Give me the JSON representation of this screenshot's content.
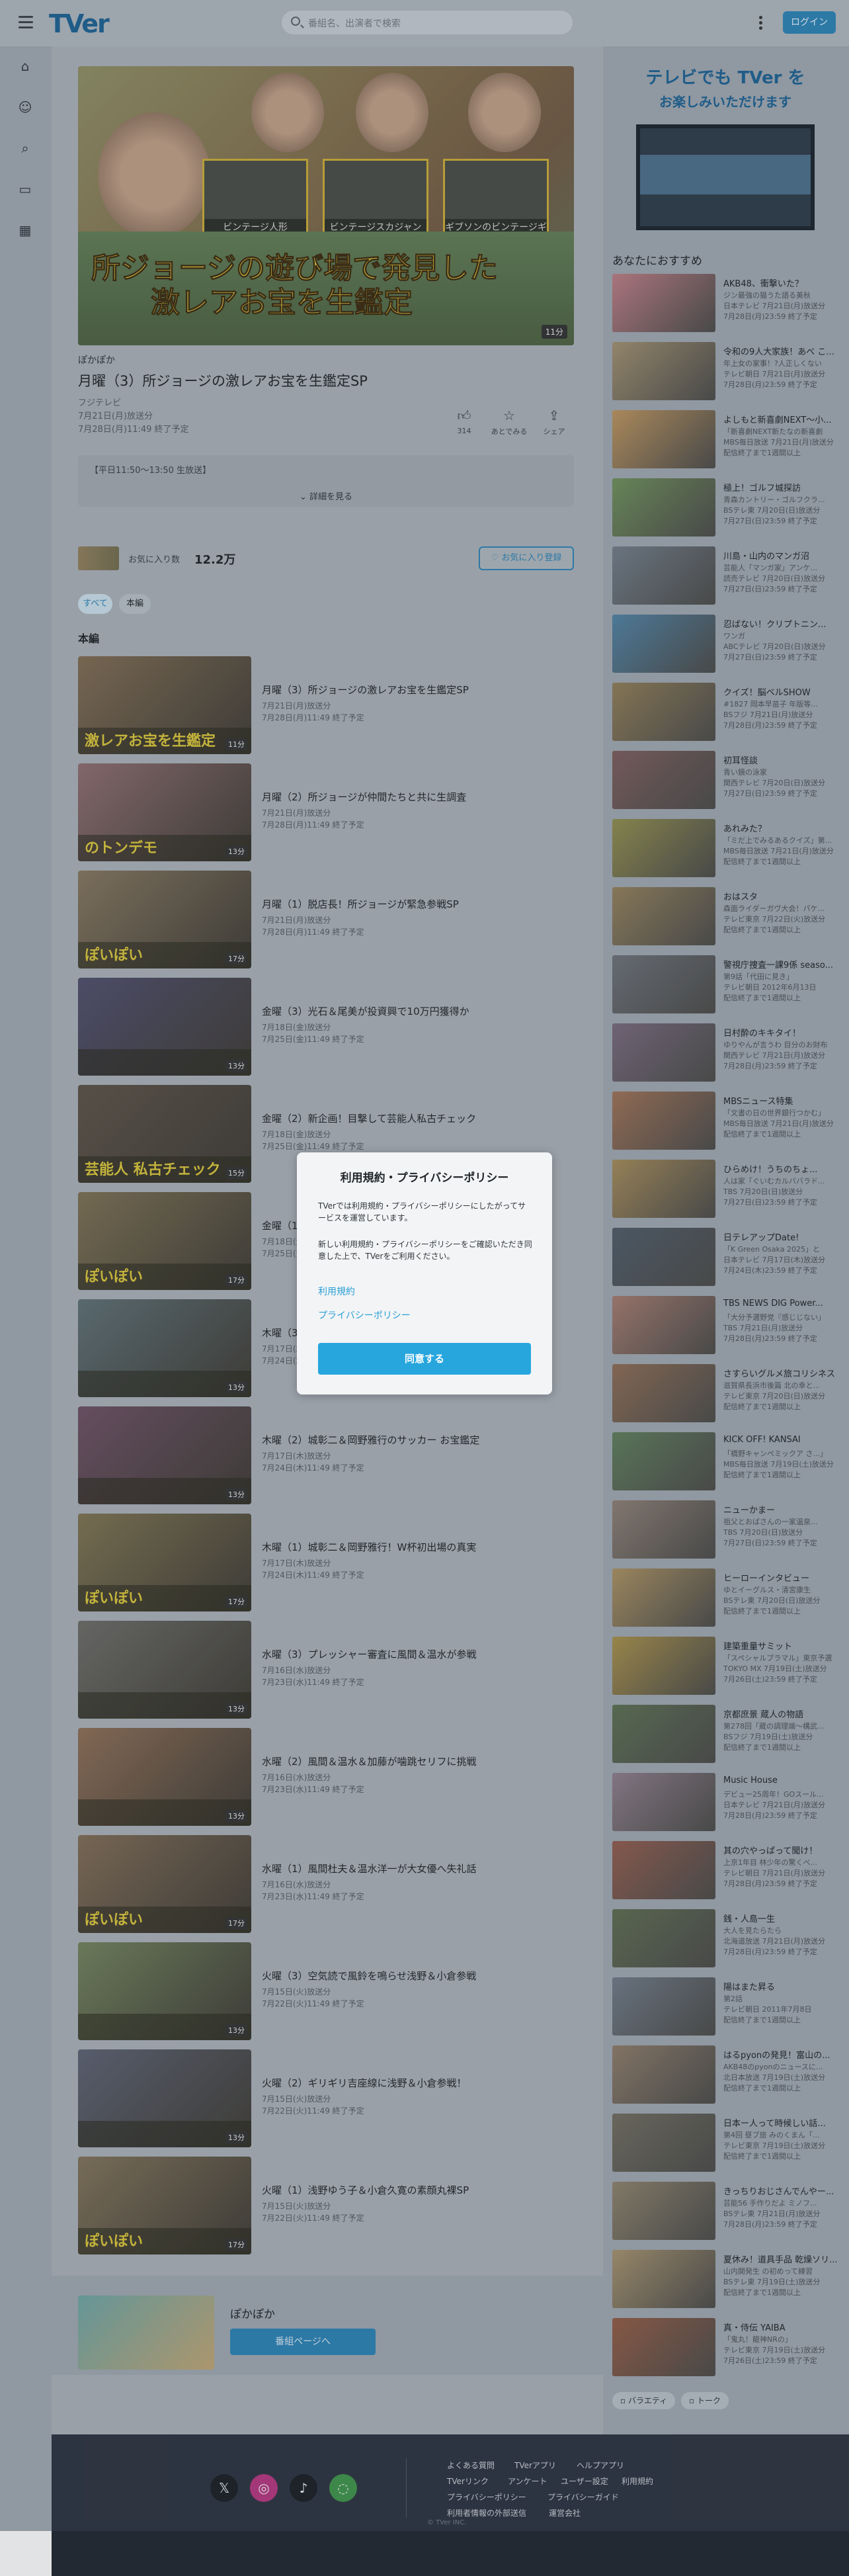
{
  "header": {
    "logo": "TVer",
    "search_placeholder": "番組名、出演者で検索",
    "login_label": "ログイン"
  },
  "rail_icons": [
    "home-icon",
    "person-icon",
    "search-icon",
    "tv-icon",
    "grid-icon"
  ],
  "hero": {
    "panels": [
      "ビンテージ人形",
      "ビンテージスカジャン",
      "ギブソンのビンテージギター"
    ],
    "title_line1": "所ジョージの遊び場で発見した",
    "title_line2": "激レアお宝を生鑑定",
    "duration": "11分"
  },
  "episode": {
    "series": "ぽかぽか",
    "title": "月曜（3）所ジョージの激レアお宝を生鑑定SP",
    "broadcaster": "フジテレビ",
    "aired": "7月21日(月)放送分",
    "expires": "7月28日(月)11:49 終了予定",
    "actions": [
      {
        "icon": "thumb-up-icon",
        "label": "314"
      },
      {
        "icon": "star-icon",
        "label": "あとでみる"
      },
      {
        "icon": "share-icon",
        "label": "シェア"
      }
    ],
    "description": "【平日11:50～13:50 生放送】",
    "more_label": "詳細を見る"
  },
  "favorites": {
    "label": "お気に入り数",
    "count": "12.2万",
    "button": "お気に入り登録"
  },
  "chips": [
    "すべて",
    "本編"
  ],
  "section_title": "本編",
  "episodes": [
    {
      "title": "月曜（3）所ジョージの激レアお宝を生鑑定SP",
      "aired": "7月21日(月)放送分",
      "expires": "7月28日(月)11:49 終了予定",
      "caption": "激レアお宝を生鑑定",
      "duration": "11分",
      "color": "#7d6a52"
    },
    {
      "title": "月曜（2）所ジョージが仲間たちと共に生調査",
      "aired": "7月21日(月)放送分",
      "expires": "7月28日(月)11:49 終了予定",
      "caption": "のトンデモ",
      "duration": "13分",
      "color": "#8a6b6e"
    },
    {
      "title": "月曜（1）脱店長！所ジョージが緊急参戦SP",
      "aired": "7月21日(月)放送分",
      "expires": "7月28日(月)11:49 終了予定",
      "caption": "ぽいぽい",
      "duration": "17分",
      "color": "#82745d"
    },
    {
      "title": "金曜（3）光石＆尾美が投資興で10万円獲得か",
      "aired": "7月18日(金)放送分",
      "expires": "7月25日(金)11:49 終了予定",
      "caption": "",
      "duration": "13分",
      "color": "#4e4d6b"
    },
    {
      "title": "金曜（2）新企画！目撃して芸能人私古チェック",
      "aired": "7月18日(金)放送分",
      "expires": "7月25日(金)11:49 終了予定",
      "caption": "芸能人 私古チェック",
      "duration": "15分",
      "color": "#5b5147"
    },
    {
      "title": "金曜（1）光石研＆尾美としのりが登場",
      "aired": "7月18日(金)放送分",
      "expires": "7月25日(金)11:49 終了予定",
      "caption": "ぽいぽい",
      "duration": "17分",
      "color": "#7a6e52"
    },
    {
      "title": "木曜（3）城彰二＆岡野雅行の秘話トーク",
      "aired": "7月17日(木)放送分",
      "expires": "7月24日(木)11:49 終了予定",
      "caption": "",
      "duration": "13分",
      "color": "#5c6d72"
    },
    {
      "title": "木曜（2）城彰二＆岡野雅行のサッカー お宝鑑定",
      "aired": "7月17日(木)放送分",
      "expires": "7月24日(木)11:49 終了予定",
      "caption": "",
      "duration": "13分",
      "color": "#6a4f62"
    },
    {
      "title": "木曜（1）城彰二＆岡野雅行！W杯初出場の真実",
      "aired": "7月17日(木)放送分",
      "expires": "7月24日(木)11:49 終了予定",
      "caption": "ぽいぽい",
      "duration": "17分",
      "color": "#7b7150"
    },
    {
      "title": "水曜（3）プレッシャー審査に風間＆温水が参戦",
      "aired": "7月16日(水)放送分",
      "expires": "7月23日(水)11:49 終了予定",
      "caption": "",
      "duration": "13分",
      "color": "#6a6a66"
    },
    {
      "title": "水曜（2）風間＆温水＆加藤が噛跳セリフに挑戦",
      "aired": "7月16日(水)放送分",
      "expires": "7月23日(水)11:49 終了予定",
      "caption": "",
      "duration": "13分",
      "color": "#8a6c55"
    },
    {
      "title": "水曜（1）風間杜夫＆温水洋一が大女優へ失礼話",
      "aired": "7月16日(水)放送分",
      "expires": "7月23日(水)11:49 終了予定",
      "caption": "ぽいぽい",
      "duration": "17分",
      "color": "#7d6a55"
    },
    {
      "title": "火曜（3）空気読で風鈴を鳴らせ浅野＆小倉参戦",
      "aired": "7月15日(火)放送分",
      "expires": "7月22日(火)11:49 終了予定",
      "caption": "",
      "duration": "13分",
      "color": "#6f7f5b"
    },
    {
      "title": "火曜（2）ギリギリ吉座線に浅野＆小倉参戦！",
      "aired": "7月15日(火)放送分",
      "expires": "7月22日(火)11:49 終了予定",
      "caption": "",
      "duration": "13分",
      "color": "#5b6070"
    },
    {
      "title": "火曜（1）浅野ゆう子＆小倉久寛の素顔丸裸SP",
      "aired": "7月15日(火)放送分",
      "expires": "7月22日(火)11:49 終了予定",
      "caption": "ぽいぽい",
      "duration": "17分",
      "color": "#7d7058"
    }
  ],
  "series_card": {
    "name": "ぽかぽか",
    "button": "番組ページへ"
  },
  "side": {
    "promo_line1": "テレビでも TVer を",
    "promo_line2": "お楽しみいただけます",
    "heading": "あなたにおすすめ",
    "items": [
      {
        "title": "AKB48、衝撃いた？",
        "sub": "ジン最強の猫うた語る美秋",
        "meta": "日本テレビ 7月21日(月)放送分",
        "exp": "7月28日(月)23:59 終了予定",
        "color": "#b77a82"
      },
      {
        "title": "令和の9人大家族！あべ こ...",
        "sub": "年上女の家事！?人正しくない",
        "meta": "テレビ朝日 7月21日(月)放送分",
        "exp": "7月28日(月)23:59 終了予定",
        "color": "#9c8c6e"
      },
      {
        "title": "よしもと新喜劇NEXT～小...",
        "sub": "「新喜劇NEXT新たなの新喜劇",
        "meta": "MBS毎日放送 7月21日(月)放送分",
        "exp": "配信終了まで1週間以上",
        "color": "#b7905d"
      },
      {
        "title": "極上！ゴルフ城探訪",
        "sub": "青森カントリー・ゴルフクラ...",
        "meta": "BSテレ東 7月20日(日)放送分",
        "exp": "7月27日(日)23:59 終了予定",
        "color": "#6c8c59"
      },
      {
        "title": "川島・山内のマンガ沼",
        "sub": "芸能人「マンガ家」アンケ...",
        "meta": "読売テレビ 7月20日(日)放送分",
        "exp": "7月27日(日)23:59 終了予定",
        "color": "#6f7a86"
      },
      {
        "title": "忍ばない！クリプトニン...",
        "sub": "ワンガ",
        "meta": "ABCテレビ 7月20日(日)放送分",
        "exp": "7月27日(日)23:59 終了予定",
        "color": "#4f7fa0"
      },
      {
        "title": "クイズ！脳ベルSHOW",
        "sub": "#1827 岡本早苗子 年版等...",
        "meta": "BSフジ 7月21日(月)放送分",
        "exp": "7月28日(月)23:59 終了予定",
        "color": "#8c7a56"
      },
      {
        "title": "初耳怪談",
        "sub": "青い鏡の泳家",
        "meta": "関西テレビ 7月20日(日)放送分",
        "exp": "7月27日(日)23:59 終了予定",
        "color": "#7a5b5b"
      },
      {
        "title": "あれみた？",
        "sub": "「ミだ上でみるあるクイズ」第...",
        "meta": "MBS毎日放送 7月21日(月)放送分",
        "exp": "配信終了まで1週間以上",
        "color": "#8d8a4d"
      },
      {
        "title": "おはスタ",
        "sub": "森面ライダーガヴ大会！パケ...",
        "meta": "テレビ東京 7月22日(火)放送分",
        "exp": "配信終了まで1週間以上",
        "color": "#8f7d5a"
      },
      {
        "title": "警視庁捜査一課9係 seaso...",
        "sub": "第9話「代田に見き」",
        "meta": "テレビ朝日 2012年6月13日",
        "exp": "配信終了まで1週間以上",
        "color": "#6a6f76"
      },
      {
        "title": "日村酔のキキタイ！",
        "sub": "ゆりやんが言うわ 目分のお財布",
        "meta": "関西テレビ 7月21日(月)放送分",
        "exp": "7月28日(月)23:59 終了予定",
        "color": "#75677a"
      },
      {
        "title": "MBSニュース特集",
        "sub": "「文書の日の世界銀行つかむ」",
        "meta": "MBS毎日放送 7月21日(月)放送分",
        "exp": "配信終了まで1週間以上",
        "color": "#9a6f55"
      },
      {
        "title": "ひらめけ！うちのちょ...",
        "sub": "人は家「ぐいむカルババラド...",
        "meta": "TBS 7月20日(日)放送分",
        "exp": "7月27日(日)23:59 終了予定",
        "color": "#a08758"
      },
      {
        "title": "日テレアップDate!",
        "sub": "「K Green Osaka 2025」と",
        "meta": "日本テレビ 7月17日(木)放送分",
        "exp": "7月24日(木)23:59 終了予定",
        "color": "#4d5966"
      },
      {
        "title": "TBS NEWS DIG Power...",
        "sub": "「大分予選野党『感じじない」",
        "meta": "TBS 7月21日(月)放送分",
        "exp": "7月28日(月)23:59 終了予定",
        "color": "#a0786d"
      },
      {
        "title": "さすらいグルメ旅コリシネス",
        "sub": "滋賀県長浜市後篇 北の幸と...",
        "meta": "テレビ東京 7月20日(日)放送分",
        "exp": "配信終了まで1週間以上",
        "color": "#8a6a54"
      },
      {
        "title": "KICK OFF! KANSAI",
        "sub": "「橋野キャンペミックア さ...」",
        "meta": "MBS毎日放送 7月19日(土)放送分",
        "exp": "配信終了まで1週間以上",
        "color": "#5d7a5a"
      },
      {
        "title": "ニューかまー",
        "sub": "祖父とおばさんの一家温泉...",
        "meta": "TBS 7月20日(日)放送分",
        "exp": "7月27日(日)23:59 終了予定",
        "color": "#8a7c73"
      },
      {
        "title": "ヒーローインタビュー",
        "sub": "ゆとイーグルス・清宮康生",
        "meta": "BSテレ東 7月20日(日)放送分",
        "exp": "配信終了まで1週間以上",
        "color": "#a58d60"
      },
      {
        "title": "建築重量サミット",
        "sub": "「スペシャルブラマル」東京予選",
        "meta": "TOKYO MX 7月19日(土)放送分",
        "exp": "7月26日(土)23:59 終了予定",
        "color": "#a38c4a"
      },
      {
        "title": "京都庶景 蔵人の物語",
        "sub": "第278回「蔵の調理端～構武...",
        "meta": "BSフジ 7月19日(土)放送分",
        "exp": "配信終了まで1週間以上",
        "color": "#5a6d52"
      },
      {
        "title": "Music House",
        "sub": "デビュー25周年！GOスール...",
        "meta": "日本テレビ 7月21日(月)放送分",
        "exp": "7月28日(月)23:59 終了予定",
        "color": "#8a7a87"
      },
      {
        "title": "其の穴やっぱって聞け！",
        "sub": "上京1年目 林少年の驚くべ...",
        "meta": "テレビ朝日 7月21日(月)放送分",
        "exp": "7月28日(月)23:59 終了予定",
        "color": "#8d5a4d"
      },
      {
        "title": "銭・人島一生",
        "sub": "大人を見たらたら",
        "meta": "北海道放送 7月21日(月)放送分",
        "exp": "7月28日(月)23:59 終了予定",
        "color": "#5c6a50"
      },
      {
        "title": "陽はまた昇る",
        "sub": "第2話",
        "meta": "テレビ朝日 2011年7月8日",
        "exp": "配信終了まで1週間以上",
        "color": "#6d7784"
      },
      {
        "title": "はるpyonの発見！富山の...",
        "sub": "AKB48のpyonのニュースに...",
        "meta": "北日本放送 7月19日(土)放送分",
        "exp": "配信終了まで1週間以上",
        "color": "#8a7968"
      },
      {
        "title": "日本ー人って時候しい話...",
        "sub": "第4回 昼ブ旅 みのくまん「...",
        "meta": "テレビ東京 7月19日(土)放送分",
        "exp": "配信終了まで1週間以上",
        "color": "#6e6a5e"
      },
      {
        "title": "きっちりおじさんでんやー...",
        "sub": "芸能56 手作りだよ ミノフ...",
        "meta": "BSテレ東 7月21日(月)放送分",
        "exp": "7月28日(月)23:59 終了予定",
        "color": "#8a7f6a"
      },
      {
        "title": "夏休み！道具手品 乾燥ソリ...",
        "sub": "山内開発生 の初めって練習",
        "meta": "BSテレ東 7月19日(土)放送分",
        "exp": "配信終了まで1週間以上",
        "color": "#a18e6c"
      },
      {
        "title": "真・侍伝 YAIBA",
        "sub": "「鬼丸！龍神NRの」",
        "meta": "テレビ東京 7月19日(土)放送分",
        "exp": "7月26日(土)23:59 終了予定",
        "color": "#8f5a45"
      }
    ],
    "tags": [
      "バラエティ",
      "トーク"
    ]
  },
  "footer": {
    "socials": [
      "x-icon",
      "instagram-icon",
      "tiktok-icon",
      "line-icon"
    ],
    "links_row1": [
      "よくある質問",
      "TVerアプリ",
      "ヘルプアプリ"
    ],
    "links_row2": [
      "TVerリンク",
      "アンケート",
      "ユーザー設定",
      "利用規約"
    ],
    "links_row3": [
      "プライバシーポリシー",
      "プライバシーガイド"
    ],
    "links_row4": [
      "利用者情報の外部送信",
      "運営会社"
    ],
    "copyright": "© TVer INC."
  },
  "modal": {
    "title": "利用規約・プライバシーポリシー",
    "p1": "TVerでは利用規約・プライバシーポリシーにしたがってサービスを運営しています。",
    "p2": "新しい利用規約・プライバシーポリシーをご確認いただき同意した上で、TVerをご利用ください。",
    "link_terms": "利用規約",
    "link_privacy": "プライバシーポリシー",
    "agree": "同意する"
  }
}
